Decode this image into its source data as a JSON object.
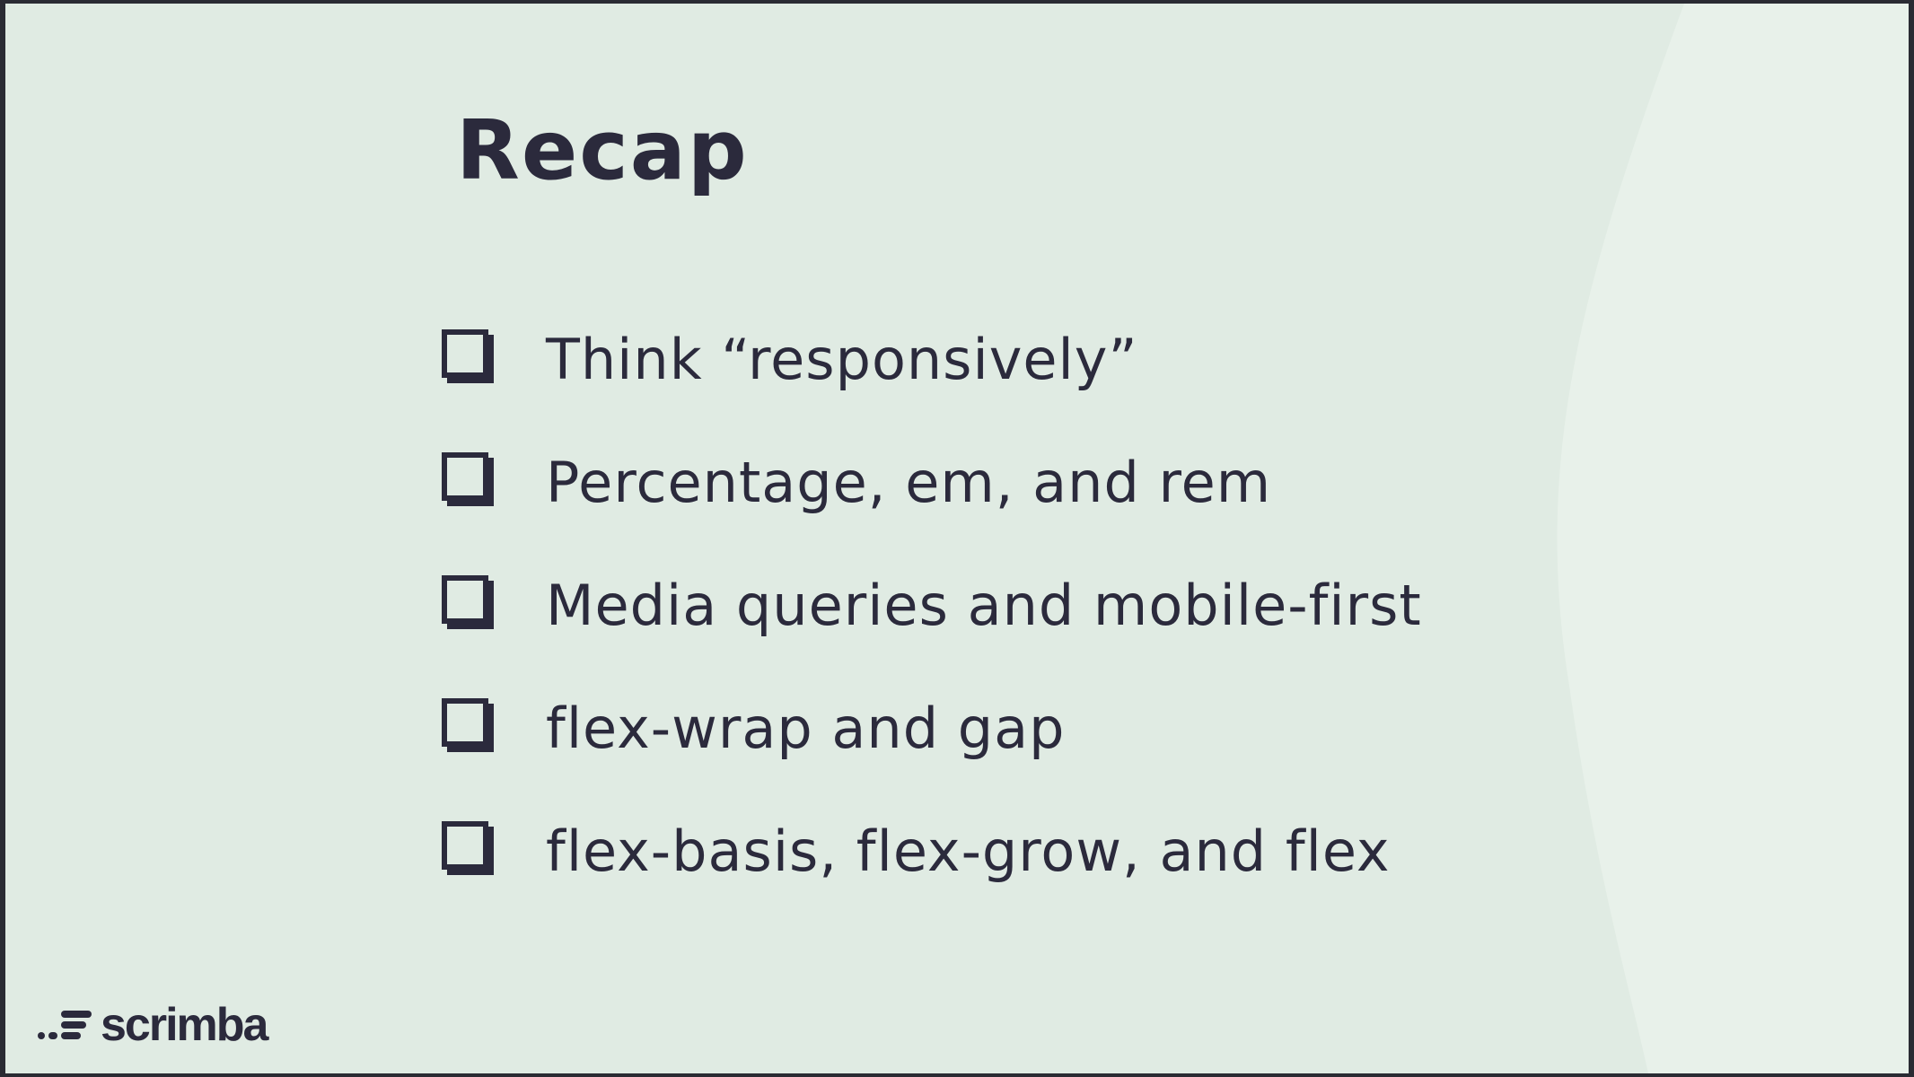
{
  "slide": {
    "title": "Recap",
    "items": [
      {
        "label": "Think “responsively”",
        "checked": false
      },
      {
        "label": "Percentage, em, and rem",
        "checked": false
      },
      {
        "label": "Media queries and mobile-first",
        "checked": false
      },
      {
        "label": "flex-wrap and gap",
        "checked": false
      },
      {
        "label": "flex-basis, flex-grow, and flex",
        "checked": false
      }
    ]
  },
  "branding": {
    "logo_text": "scrimba",
    "logo_icon": "scrimba-dots-icon"
  },
  "colors": {
    "background": "#e0ebe3",
    "background_light": "#e8f1ea",
    "text": "#2b2a3c",
    "frame": "#2a2b33"
  }
}
